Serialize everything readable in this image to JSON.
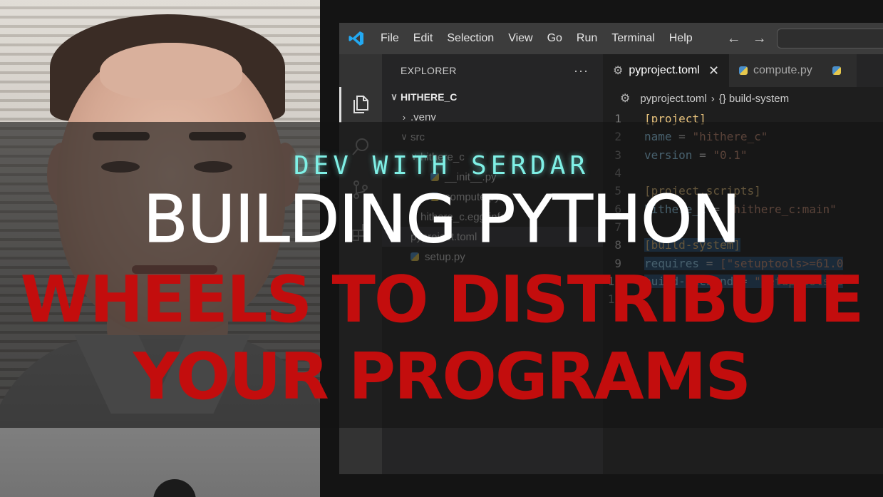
{
  "window": {
    "menu": [
      "File",
      "Edit",
      "Selection",
      "View",
      "Go",
      "Run",
      "Terminal",
      "Help"
    ]
  },
  "sidebar": {
    "title": "EXPLORER",
    "more": "···",
    "tree": [
      {
        "label": "HITHERE_C",
        "chev": "∨",
        "indent": 0,
        "style": "bold"
      },
      {
        "label": ".venv",
        "chev": "›",
        "indent": 1,
        "style": ""
      },
      {
        "label": "src",
        "chev": "∨",
        "indent": 1,
        "style": ""
      },
      {
        "label": "hithere_c",
        "chev": "∨",
        "indent": 2,
        "style": ""
      },
      {
        "label": "__init__.py",
        "chev": "",
        "indent": 3,
        "style": "py"
      },
      {
        "label": "compute.py",
        "chev": "",
        "indent": 3,
        "style": "py"
      },
      {
        "label": "hithere_c.egg-info",
        "chev": "›",
        "indent": 2,
        "style": ""
      },
      {
        "label": "pyproject.toml",
        "chev": "",
        "indent": 1,
        "style": "selected"
      },
      {
        "label": "setup.py",
        "chev": "",
        "indent": 1,
        "style": "py"
      }
    ]
  },
  "editor": {
    "tabs": [
      {
        "label": "pyproject.toml",
        "active": true,
        "close": "✕"
      },
      {
        "label": "compute.py",
        "active": false
      }
    ],
    "breadcrumb": {
      "file": "pyproject.toml",
      "sep": "›",
      "symbol": "{} build-system"
    },
    "lines": [
      {
        "n": "1",
        "text": "[project]",
        "kind": "sec",
        "sel": false
      },
      {
        "n": "2",
        "text": "name = \"hithere_c\"",
        "kind": "kv",
        "sel": false
      },
      {
        "n": "3",
        "text": "version = \"0.1\"",
        "kind": "kv",
        "sel": false
      },
      {
        "n": "4",
        "text": "",
        "kind": "blank",
        "sel": false
      },
      {
        "n": "5",
        "text": "[project.scripts]",
        "kind": "sec",
        "sel": false
      },
      {
        "n": "6",
        "text": "hithere_c = \"hithere_c:main\"",
        "kind": "kv",
        "sel": false
      },
      {
        "n": "7",
        "text": "",
        "kind": "blank",
        "sel": false
      },
      {
        "n": "8",
        "text": "[build-system]",
        "kind": "sec",
        "sel": true
      },
      {
        "n": "9",
        "text": "requires = [\"setuptools>=61.0",
        "kind": "kv",
        "sel": true
      },
      {
        "n": "10",
        "text": "build-backend = \"setuptools.b",
        "kind": "kv",
        "sel": true
      },
      {
        "n": "11",
        "text": "",
        "kind": "blank",
        "sel": false
      }
    ]
  },
  "overlay": {
    "channel": "DEV WITH SERDAR",
    "title_line1": "BUILDING PYTHON",
    "title_line2": "WHEELS TO DISTRIBUTE",
    "title_line3": "YOUR PROGRAMS"
  },
  "colors": {
    "title_red": "#c30d0d",
    "channel_cyan": "#7ff0e6",
    "vscode_blue": "#23a9f2"
  }
}
